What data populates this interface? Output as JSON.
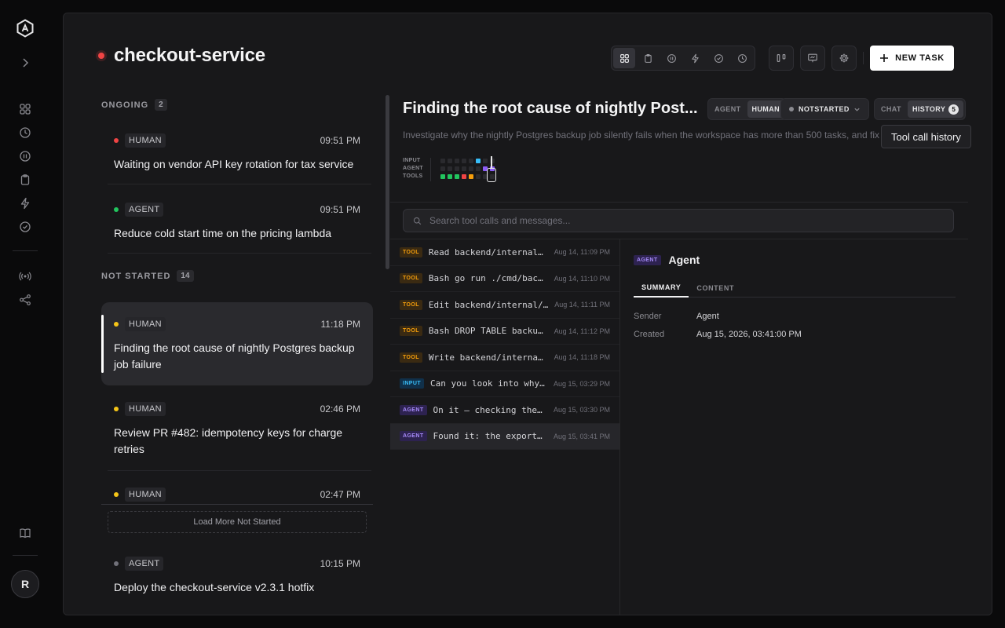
{
  "avatar_initial": "R",
  "project": {
    "name": "checkout-service"
  },
  "toolbar": {
    "new_task_label": "NEW TASK"
  },
  "sections": {
    "ongoing": {
      "label": "ONGOING",
      "count": "2"
    },
    "not_started": {
      "label": "NOT STARTED",
      "count": "14"
    }
  },
  "tasks": [
    {
      "kind": "HUMAN",
      "time": "09:51 PM",
      "title": "Waiting on vendor API key rotation for tax service",
      "status_color": "#ef4444"
    },
    {
      "kind": "AGENT",
      "time": "09:51 PM",
      "title": "Reduce cold start time on the pricing lambda",
      "status_color": "#22c55e"
    },
    {
      "kind": "HUMAN",
      "time": "11:18 PM",
      "title": "Finding the root cause of nightly Postgres backup job failure",
      "status_color": "#f5c518"
    },
    {
      "kind": "HUMAN",
      "time": "02:46 PM",
      "title": "Review PR #482: idempotency keys for charge retries",
      "status_color": "#f5c518"
    },
    {
      "kind": "HUMAN",
      "time": "02:47 PM",
      "title": "",
      "status_color": "#f5c518"
    },
    {
      "kind": "AGENT",
      "time": "10:15 PM",
      "title": "Deploy the checkout-service v2.3.1 hotfix",
      "status_color": "#71717a"
    }
  ],
  "load_more_label": "Load More Not Started",
  "detail": {
    "title": "Finding the root cause of nightly Post...",
    "assignee": {
      "label": "AGENT",
      "value": "HUMAN"
    },
    "status": "NOTSTARTED",
    "view": {
      "chat": "CHAT",
      "history": "HISTORY",
      "history_count": "5"
    },
    "description": "Investigate why the nightly Postgres backup job silently fails when the workspace has more than 500 tasks, and fix t",
    "tooltip": "Tool call history",
    "timeline_labels": [
      "INPUT",
      "AGENT",
      "TOOLS"
    ],
    "search_placeholder": "Search tool calls and messages..."
  },
  "events": [
    {
      "type": "TOOL",
      "text": "Read backend/internal/…",
      "time": "Aug 14, 11:09 PM"
    },
    {
      "type": "TOOL",
      "text": "Bash go run ./cmd/back…",
      "time": "Aug 14, 11:10 PM"
    },
    {
      "type": "TOOL",
      "text": "Edit backend/internal/…",
      "time": "Aug 14, 11:11 PM"
    },
    {
      "type": "TOOL",
      "text": "Bash DROP TABLE backup…",
      "time": "Aug 14, 11:12 PM"
    },
    {
      "type": "TOOL",
      "text": "Write backend/internal…",
      "time": "Aug 14, 11:18 PM"
    },
    {
      "type": "INPUT",
      "text": "Can you look into why…",
      "time": "Aug 15, 03:29 PM"
    },
    {
      "type": "AGENT",
      "text": "On it — checking the…",
      "time": "Aug 15, 03:30 PM"
    },
    {
      "type": "AGENT",
      "text": "Found it: the export…",
      "time": "Aug 15, 03:41 PM"
    }
  ],
  "inspector": {
    "badge": "AGENT",
    "name": "Agent",
    "tabs": [
      "SUMMARY",
      "CONTENT"
    ],
    "sender_label": "Sender",
    "sender_value": "Agent",
    "created_label": "Created",
    "created_value": "Aug 15, 2026, 03:41:00 PM"
  }
}
